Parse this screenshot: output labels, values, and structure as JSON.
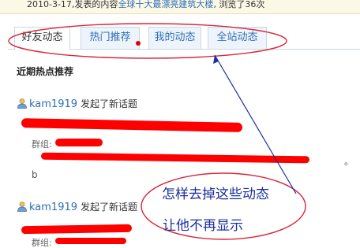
{
  "top_bar": {
    "prefix": "2010-3-17,发表的内容",
    "link": "全球十大最漂亮建筑大楼",
    "suffix": ", 浏览了36次"
  },
  "tabs": [
    {
      "label": "好友动态",
      "active": true
    },
    {
      "label": "热门推荐",
      "active": false
    },
    {
      "label": "我的动态",
      "active": false
    },
    {
      "label": "全站动态",
      "active": false
    }
  ],
  "section": {
    "title": "近期热点推荐"
  },
  "feed": [
    {
      "user": "kam1919",
      "action": "发起了新话题",
      "group_label": "群组:"
    },
    {
      "user": "kam1919",
      "action": "发起了新话题",
      "group_label": "群组:"
    }
  ],
  "fragments": {
    "left_b": "b",
    "right_dot": "。"
  },
  "annotation": {
    "line1": "怎样去掉这些动态",
    "line2": "让他不再显示"
  },
  "colors": {
    "link": "#2f6fb6",
    "annotation": "#1b2f9f",
    "redaction": "#ff0000",
    "ellipse": "#d9263a"
  },
  "icons": {
    "user": "user-icon"
  }
}
